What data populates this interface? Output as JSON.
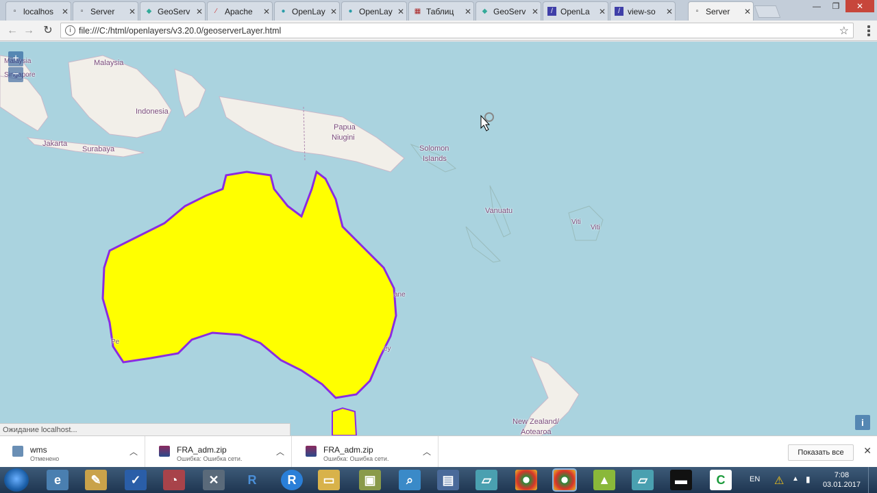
{
  "tabs": [
    {
      "label": "localhos",
      "icon": "page-icon"
    },
    {
      "label": "Server",
      "icon": "page-icon"
    },
    {
      "label": "GeoServ",
      "icon": "geoserver-icon"
    },
    {
      "label": "Apache",
      "icon": "apache-feather-icon"
    },
    {
      "label": "OpenLay",
      "icon": "openlayers-icon"
    },
    {
      "label": "OpenLay",
      "icon": "openlayers-icon"
    },
    {
      "label": "Таблиц",
      "icon": "table-icon"
    },
    {
      "label": "GeoServ",
      "icon": "geoserver-icon"
    },
    {
      "label": "OpenLa",
      "icon": "phpstorm-icon"
    },
    {
      "label": "view-so",
      "icon": "phpstorm-icon"
    },
    {
      "label": "Server",
      "icon": "page-icon"
    }
  ],
  "toolbar": {
    "url": "file:///C:/html/openlayers/v3.20.0/geoserverLayer.html"
  },
  "map": {
    "labels": [
      {
        "text": "Malaysia"
      },
      {
        "text": "Malaysia"
      },
      {
        "text": "Singapore"
      },
      {
        "text": "Indonesia"
      },
      {
        "text": "Jakarta"
      },
      {
        "text": "Surabaya"
      },
      {
        "text": "Papua"
      },
      {
        "text": "Niugini"
      },
      {
        "text": "Solomon"
      },
      {
        "text": "Islands"
      },
      {
        "text": "Vanuatu"
      },
      {
        "text": "Viti"
      },
      {
        "text": "Viti"
      },
      {
        "text": "New Zealand/"
      },
      {
        "text": "Aotearoa"
      },
      {
        "text": "ane"
      },
      {
        "text": "ey"
      },
      {
        "text": "Pe"
      }
    ],
    "zoom_in": "+",
    "zoom_out": "−",
    "attribution": "i",
    "status": "Ожидание localhost..."
  },
  "downloads": [
    {
      "name": "wms",
      "status": "Отменено",
      "icon": "wms-file-icon"
    },
    {
      "name": "FRA_adm.zip",
      "status": "Ошибка: Ошибка сети.",
      "icon": "winrar-icon"
    },
    {
      "name": "FRA_adm.zip",
      "status": "Ошибка: Ошибка сети.",
      "icon": "winrar-icon"
    }
  ],
  "shelf": {
    "show_all": "Показать все"
  },
  "taskbar": {
    "items": [
      "ie-icon",
      "paint-icon",
      "todo-icon",
      "speed-icon",
      "tools-icon",
      "r-icon",
      "r-blue-icon",
      "explorer-icon",
      "package-icon",
      "search-icon",
      "python-file-icon",
      "notepad-icon",
      "chrome-icon",
      "chrome-active-icon",
      "chart-icon",
      "notepad2-icon",
      "cmd-icon",
      "c-icon"
    ],
    "lang": "EN",
    "time": "7:08",
    "date": "03.01.2017"
  },
  "colors": {
    "australia_fill": "#ffff00",
    "australia_border": "#8a2be2",
    "sea": "#aad3df",
    "land": "#f2efe9"
  }
}
